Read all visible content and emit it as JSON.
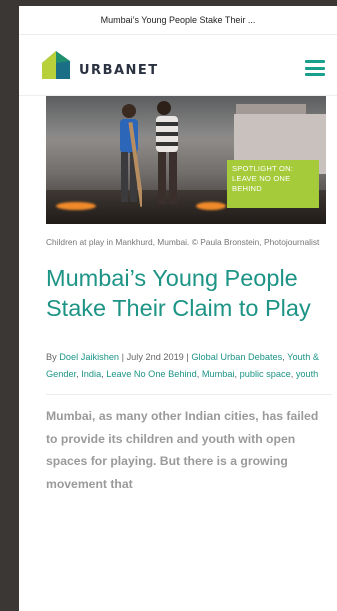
{
  "browser": {
    "tab_title": "Mumbai’s Young People Stake Their ..."
  },
  "header": {
    "brand": "URBANET",
    "menu_icon": "hamburger-menu-icon"
  },
  "hero": {
    "badge_lines": [
      "SPOTLIGHT ON:",
      "LEAVE NO ONE",
      "BEHIND"
    ],
    "caption": "Children at play in Mankhurd, Mumbai. © Paula Bronstein, Photojournalist"
  },
  "article": {
    "title": "Mumbai’s Young People Stake Their Claim to Play",
    "by_prefix": "By",
    "author": "Doel Jaikishen",
    "sep1": "|",
    "date": "July 2nd 2019",
    "sep2": "|",
    "categories": [
      "Global Urban Debates",
      "Youth & Gender",
      "India",
      "Leave No One Behind",
      "Mumbai",
      "public space",
      "youth"
    ],
    "lede": "Mumbai, as many other Indian cities, has failed to provide its children and youth with open spaces for playing. But there is a growing movement that"
  },
  "colors": {
    "accent": "#1d9486",
    "badge": "#a5ca3a",
    "menu": "#18a08c"
  }
}
